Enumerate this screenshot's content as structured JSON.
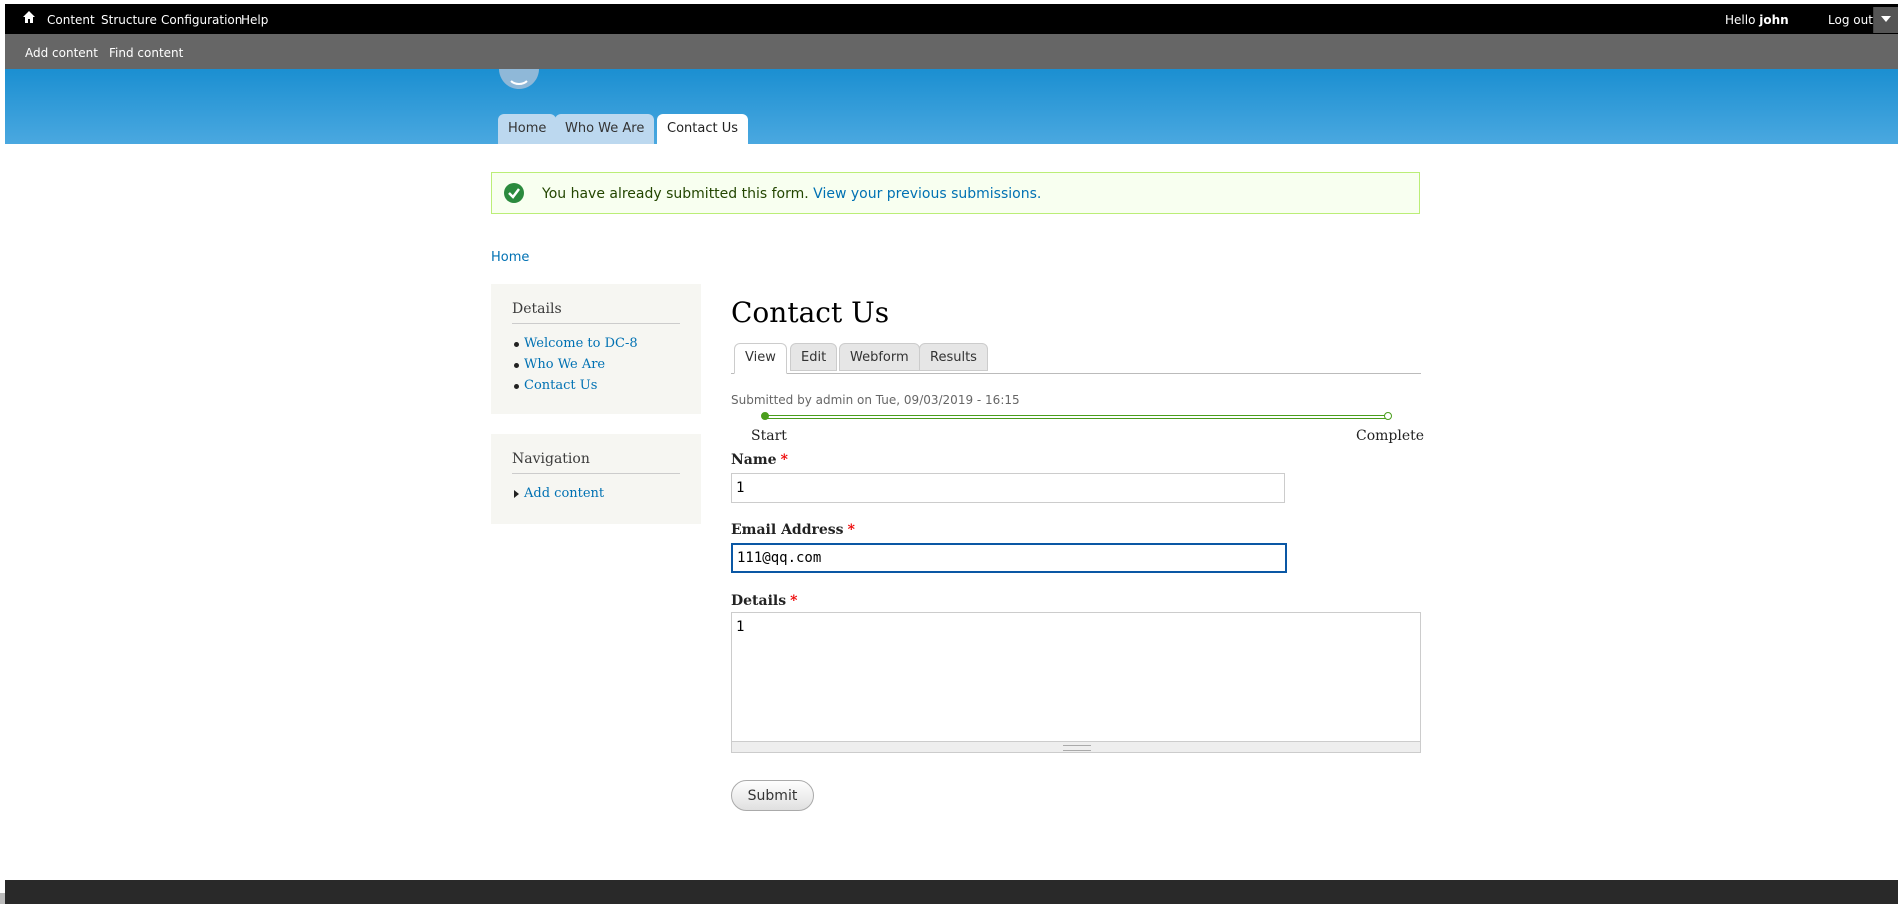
{
  "toolbar": {
    "menu": [
      "Content",
      "Structure",
      "Configuration",
      "Help"
    ],
    "hello_prefix": "Hello ",
    "username": "john",
    "logout": "Log out"
  },
  "shortcuts": [
    "Add content",
    "Find content"
  ],
  "primary_tabs": [
    "Home",
    "Who We Are",
    "Contact Us"
  ],
  "status_message": {
    "text": "You have already submitted this form.",
    "link": "View your previous submissions."
  },
  "breadcrumb": "Home",
  "sidebar": {
    "details": {
      "title": "Details",
      "items": [
        "Welcome to DC-8",
        "Who We Are",
        "Contact Us"
      ]
    },
    "navigation": {
      "title": "Navigation",
      "items": [
        "Add content"
      ]
    }
  },
  "page": {
    "title": "Contact Us",
    "tabs": [
      "View",
      "Edit",
      "Webform",
      "Results"
    ],
    "submitted": "Submitted by admin on Tue, 09/03/2019 - 16:15"
  },
  "progress": {
    "start_label": "Start",
    "end_label": "Complete"
  },
  "form": {
    "name_label": "Name",
    "name_value": "1",
    "email_label": "Email Address",
    "email_value": "111@qq.com",
    "details_label": "Details",
    "details_value": "1",
    "required_mark": "*",
    "submit_label": "Submit"
  },
  "colors": {
    "toolbar": "#000000",
    "shortcuts": "#666666",
    "header": "#1b8fd1",
    "link": "#0071b3",
    "success": "#4a9e1c",
    "required": "#ee0000",
    "focus": "#0a57a4"
  }
}
